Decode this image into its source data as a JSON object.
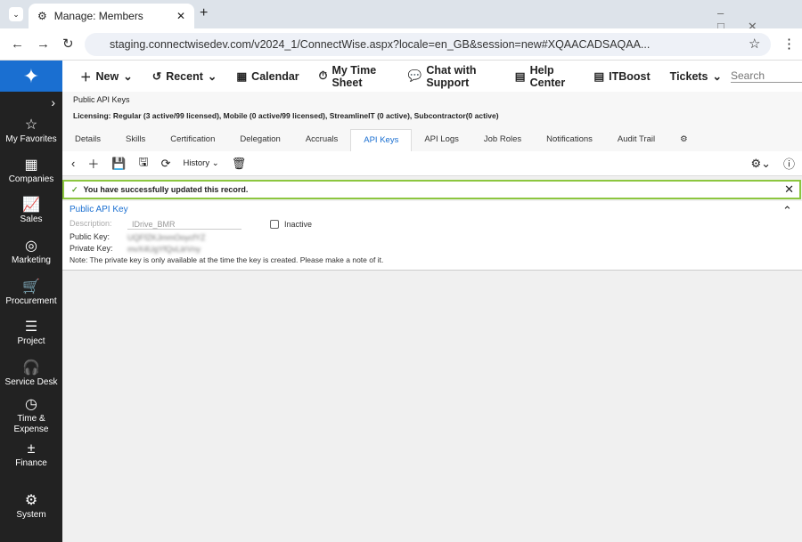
{
  "browser": {
    "tab_title": "Manage: Members",
    "url": "staging.connectwisedev.com/v2024_1/ConnectWise.aspx?locale=en_GB&session=new#XQAACADSAQAA..."
  },
  "nav": {
    "items": [
      "New",
      "Recent",
      "Calendar",
      "My Time Sheet",
      "Chat with Support",
      "Help Center",
      "ITBoost",
      "Tickets"
    ],
    "search_placeholder": "Search"
  },
  "sidebar": {
    "items": [
      "My Favorites",
      "Companies",
      "Sales",
      "Marketing",
      "Procurement",
      "Project",
      "Service Desk",
      "Time &\nExpense",
      "Finance",
      "System"
    ]
  },
  "header": {
    "title": "Public API Keys",
    "licensing": "Licensing: Regular (3 active/99 licensed), Mobile (0 active/99 licensed), StreamlineIT (0 active), Subcontractor(0 active)"
  },
  "tabs": [
    "Details",
    "Skills",
    "Certification",
    "Delegation",
    "Accruals",
    "API Keys",
    "API Logs",
    "Job Roles",
    "Notifications",
    "Audit Trail"
  ],
  "active_tab": "API Keys",
  "toolbar": {
    "history": "History"
  },
  "message": "You have successfully updated this record.",
  "panel": {
    "title": "Public API Key",
    "description_label": "Description:",
    "description_value": "IDrive_BMR",
    "inactive_label": "Inactive",
    "public_key_label": "Public Key:",
    "public_key_value": "UQFfZKJmmOoycfYZ",
    "private_key_label": "Private Key:",
    "private_key_value": "mvX4UgYfQvLiirVny",
    "note": "Note: The private key is only available at the time the key is created. Please make a note of it."
  },
  "colors": {
    "brand": "#1a6fd1",
    "success": "#8cc63f",
    "sidebar": "#222222"
  }
}
